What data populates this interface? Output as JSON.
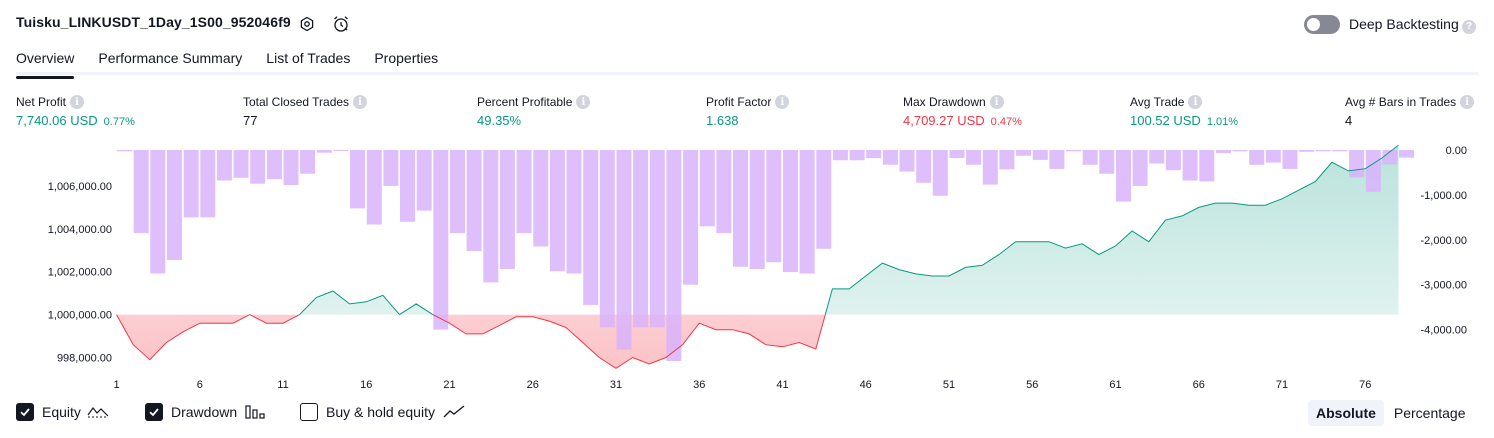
{
  "header": {
    "title": "Tuisku_LINKUSDT_1Day_1S00_952046f9",
    "deep_backtesting_label": "Deep Backtesting",
    "deep_backtesting_on": false
  },
  "tabs": [
    {
      "label": "Overview",
      "active": true
    },
    {
      "label": "Performance Summary",
      "active": false
    },
    {
      "label": "List of Trades",
      "active": false
    },
    {
      "label": "Properties",
      "active": false
    }
  ],
  "metrics": [
    {
      "label": "Net Profit",
      "value": "7,740.06 USD",
      "pct": "0.77%",
      "color": "green"
    },
    {
      "label": "Total Closed Trades",
      "value": "77",
      "pct": "",
      "color": "dark"
    },
    {
      "label": "Percent Profitable",
      "value": "49.35%",
      "pct": "",
      "color": "green"
    },
    {
      "label": "Profit Factor",
      "value": "1.638",
      "pct": "",
      "color": "green"
    },
    {
      "label": "Max Drawdown",
      "value": "4,709.27 USD",
      "pct": "0.47%",
      "color": "red"
    },
    {
      "label": "Avg Trade",
      "value": "100.52 USD",
      "pct": "1.01%",
      "color": "green"
    },
    {
      "label": "Avg # Bars in Trades",
      "value": "4",
      "pct": "",
      "color": "dark"
    }
  ],
  "legend": {
    "equity_label": "Equity",
    "equity_checked": true,
    "drawdown_label": "Drawdown",
    "drawdown_checked": true,
    "buyhold_label": "Buy & hold equity",
    "buyhold_checked": false
  },
  "view_toggle": {
    "absolute_label": "Absolute",
    "percentage_label": "Percentage",
    "active": "Absolute"
  },
  "colors": {
    "equity_up": "#089981",
    "equity_down": "#f23645",
    "drawdown_bar": "#d9b3fb"
  },
  "chart_data": {
    "type": "line",
    "x_ticks": [
      "1",
      "6",
      "11",
      "16",
      "21",
      "26",
      "31",
      "36",
      "41",
      "46",
      "51",
      "56",
      "61",
      "66",
      "71",
      "76"
    ],
    "y_left_ticks": [
      "1,006,000.00",
      "1,004,000.00",
      "1,002,000.00",
      "1,000,000.00",
      "998,000.00"
    ],
    "y_right_ticks": [
      "0.00",
      "-1,000.00",
      "-2,000.00",
      "-3,000.00",
      "-4,000.00"
    ],
    "ylim_left": [
      997000,
      1008000
    ],
    "ylim_right": [
      -4900,
      0
    ],
    "baseline": 1000000,
    "series": [
      {
        "name": "Equity",
        "x": [
          1,
          2,
          3,
          4,
          5,
          6,
          7,
          8,
          9,
          10,
          11,
          12,
          13,
          14,
          15,
          16,
          17,
          18,
          19,
          20,
          21,
          22,
          23,
          24,
          25,
          26,
          27,
          28,
          29,
          30,
          31,
          32,
          33,
          34,
          35,
          36,
          37,
          38,
          39,
          40,
          41,
          42,
          43,
          44,
          45,
          46,
          47,
          48,
          49,
          50,
          51,
          52,
          53,
          54,
          55,
          56,
          57,
          58,
          59,
          60,
          61,
          62,
          63,
          64,
          65,
          66,
          67,
          68,
          69,
          70,
          71,
          72,
          73,
          74,
          75,
          76,
          77,
          78
        ],
        "values": [
          1000000,
          998600,
          997900,
          998700,
          999200,
          999600,
          999600,
          999600,
          1000000,
          999600,
          999600,
          1000000,
          1000800,
          1001100,
          1000500,
          1000600,
          1000900,
          1000000,
          1000500,
          1000000,
          999600,
          999100,
          999100,
          999500,
          999900,
          999900,
          999700,
          999400,
          998700,
          998000,
          997500,
          998000,
          997700,
          998000,
          998600,
          999600,
          999300,
          999300,
          999100,
          998600,
          998500,
          998700,
          998400,
          1001200,
          1001200,
          1001800,
          1002400,
          1002100,
          1001900,
          1001800,
          1001800,
          1002200,
          1002300,
          1002800,
          1003400,
          1003400,
          1003400,
          1003100,
          1003300,
          1002800,
          1003200,
          1003900,
          1003400,
          1004400,
          1004600,
          1005000,
          1005200,
          1005200,
          1005100,
          1005100,
          1005400,
          1005800,
          1006200,
          1007100,
          1006700,
          1006800,
          1007300,
          1007900
        ]
      },
      {
        "name": "Drawdown",
        "x": [
          1,
          2,
          3,
          4,
          5,
          6,
          7,
          8,
          9,
          10,
          11,
          12,
          13,
          14,
          15,
          16,
          17,
          18,
          19,
          20,
          21,
          22,
          23,
          24,
          25,
          26,
          27,
          28,
          29,
          30,
          31,
          32,
          33,
          34,
          35,
          36,
          37,
          38,
          39,
          40,
          41,
          42,
          43,
          44,
          45,
          46,
          47,
          48,
          49,
          50,
          51,
          52,
          53,
          54,
          55,
          56,
          57,
          58,
          59,
          60,
          61,
          62,
          63,
          64,
          65,
          66,
          67,
          68,
          69,
          70,
          71,
          72,
          73,
          74,
          75,
          76,
          77,
          78
        ],
        "values": [
          -30,
          -1850,
          -2750,
          -2450,
          -1500,
          -1500,
          -680,
          -620,
          -750,
          -650,
          -780,
          -530,
          -60,
          -20,
          -1300,
          -1660,
          -800,
          -1600,
          -1350,
          -4000,
          -1850,
          -2250,
          -2950,
          -2650,
          -1850,
          -2150,
          -2700,
          -2750,
          -3450,
          -3950,
          -4450,
          -3950,
          -3950,
          -4700,
          -3000,
          -1700,
          -1850,
          -2600,
          -2650,
          -2500,
          -2720,
          -2750,
          -2200,
          -230,
          -230,
          -180,
          -330,
          -480,
          -730,
          -1020,
          -180,
          -330,
          -770,
          -430,
          -130,
          -220,
          -420,
          -30,
          -330,
          -530,
          -1150,
          -800,
          -300,
          -450,
          -680,
          -700,
          -70,
          -30,
          -330,
          -280,
          -420,
          -40,
          -30,
          -30,
          -610,
          -930,
          -320,
          -170
        ]
      }
    ]
  }
}
